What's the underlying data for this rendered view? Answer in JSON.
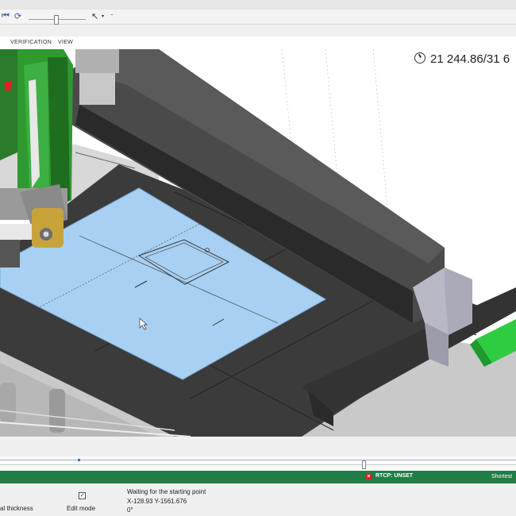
{
  "toolbar": {
    "rewind_icon": "skip-back-icon",
    "refresh_icon": "refresh-icon",
    "pointer_icon": "cursor-arrow-icon",
    "dropdown_icon": "chevron-down-icon"
  },
  "ribbon": {
    "tabs": [
      "VERIFICATION",
      "VIEW"
    ]
  },
  "viewport": {
    "coordinate_readout": "21 244.86/31 6"
  },
  "status": {
    "rtcp_label": "RTCP: UNSET",
    "shortest_label": "Shortest",
    "accent_color": "#1e7e45"
  },
  "bottom_panel": {
    "thickness_label": "al thickness",
    "edit_mode_label": "Edit mode",
    "message": "Waiting for the starting point",
    "coords": "X-128.93 Y-1561.676",
    "angle": "0°"
  }
}
